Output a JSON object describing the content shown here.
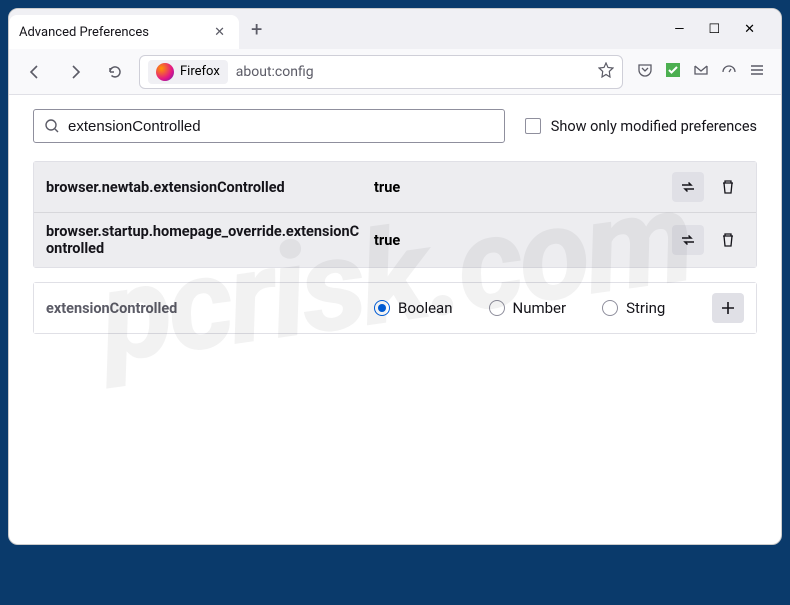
{
  "window": {
    "tab_title": "Advanced Preferences",
    "minimize": "—",
    "maximize": "☐",
    "close": "✕"
  },
  "toolbar": {
    "identity_label": "Firefox",
    "url": "about:config"
  },
  "search": {
    "value": "extensionControlled",
    "checkbox_label": "Show only modified preferences"
  },
  "prefs": [
    {
      "name": "browser.newtab.extensionControlled",
      "value": "true"
    },
    {
      "name": "browser.startup.homepage_override.extensionControlled",
      "value": "true"
    }
  ],
  "new_pref": {
    "name": "extensionControlled",
    "type_options": {
      "boolean": "Boolean",
      "number": "Number",
      "string": "String"
    }
  },
  "watermark": "pcrisk.com"
}
